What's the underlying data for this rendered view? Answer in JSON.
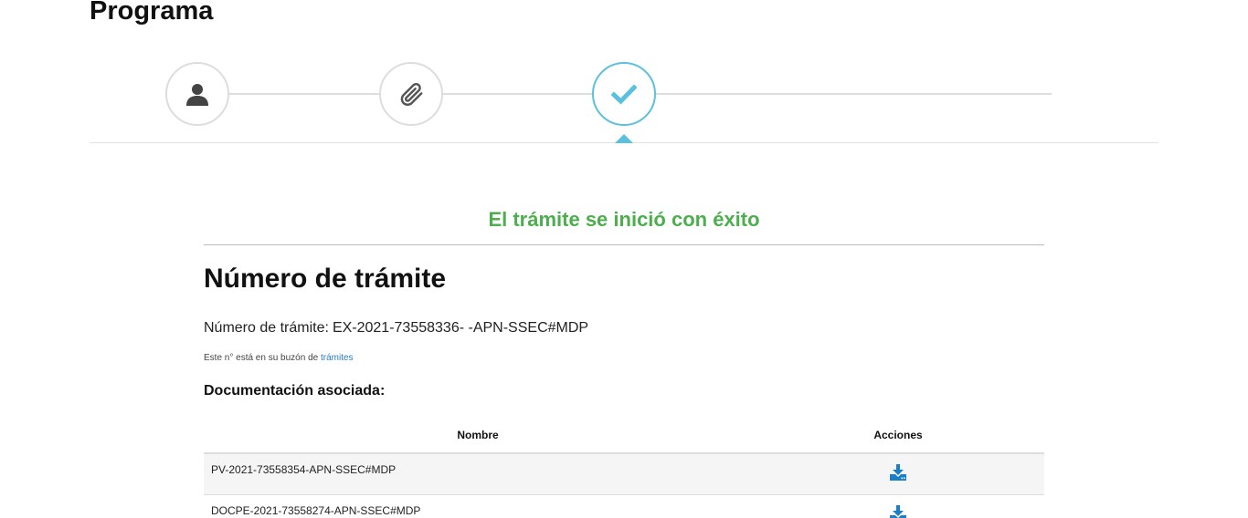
{
  "page": {
    "title": "Programa"
  },
  "stepper": {
    "steps": [
      {
        "icon": "user-icon",
        "state": "done"
      },
      {
        "icon": "paperclip-icon",
        "state": "done"
      },
      {
        "icon": "check-icon",
        "state": "active"
      }
    ],
    "colors": {
      "active": "#5bc0de",
      "inactive": "#dddddd"
    }
  },
  "result": {
    "success_message": "El trámite se inició con éxito",
    "success_color": "#4cae4c",
    "heading": "Número de trámite",
    "number_label": "Número de trámite:",
    "number_value": "EX-2021-73558336- -APN-SSEC#MDP",
    "inbox_note_prefix": "Este n° está en su buzón de",
    "inbox_link": "trámites",
    "docs_label": "Documentación asociada:"
  },
  "table": {
    "headers": {
      "name": "Nombre",
      "actions": "Acciones"
    },
    "rows": [
      {
        "name": "PV-2021-73558354-APN-SSEC#MDP",
        "action_icon": "download-icon"
      },
      {
        "name": "DOCPE-2021-73558274-APN-SSEC#MDP",
        "action_icon": "download-icon"
      }
    ],
    "action_color": "#1a7fc6"
  }
}
